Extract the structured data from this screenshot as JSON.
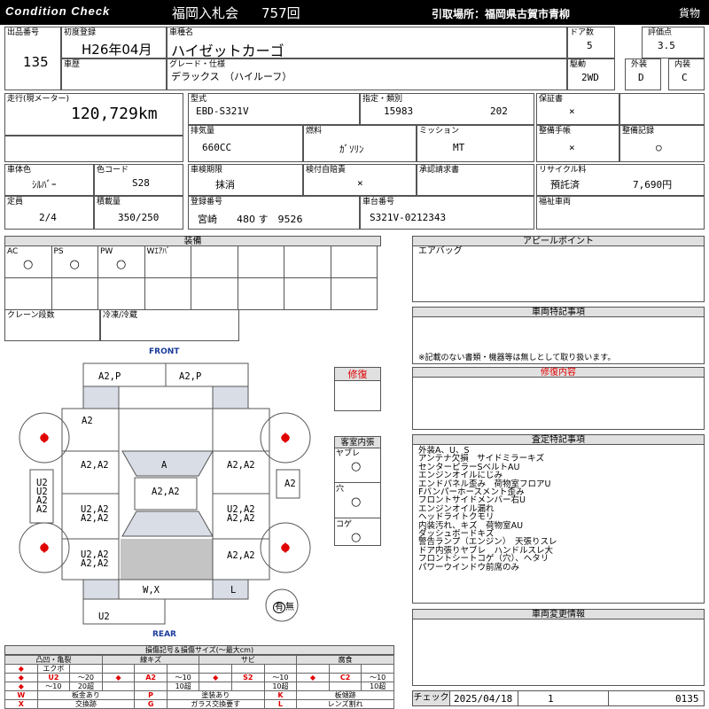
{
  "header": {
    "title_left": "Condition Check",
    "auction": "福岡入札会",
    "lot_no": "757回",
    "pickup": "引取場所：福岡県古賀市青柳",
    "kind": "貨物"
  },
  "info": {
    "lot_label": "出品番号",
    "lot": "135",
    "first_reg_label": "初度登録",
    "first_reg": "H26年04月",
    "history_label": "車歴",
    "model_label": "車種名",
    "model": "ハイゼットカーゴ",
    "grade_label": "グレード・仕様",
    "grade": "デラックス　（ハイルーフ）",
    "doors_label": "ドア数",
    "doors": "5",
    "score_label": "評価点",
    "score": "3.5",
    "drive_label": "駆動",
    "drive": "2WD",
    "ext_label": "外装",
    "ext": "D",
    "int_label": "内装",
    "int": "C",
    "mileage_label": "走行(現メーター)",
    "mileage": "120,729km",
    "type_label": "型式",
    "type": "EBD-S321V",
    "designation_label": "指定・類別",
    "designation": "15983",
    "class": "202",
    "warranty_label": "保証書",
    "warranty": "×",
    "displacement_label": "排気量",
    "displacement": "660CC",
    "fuel_label": "燃料",
    "fuel": "ｶﾞｿﾘﾝ",
    "mission_label": "ミッション",
    "mission": "MT",
    "manual_label": "整備手帳",
    "manual": "×",
    "record_label": "整備記録",
    "record": "○",
    "color_label": "車体色",
    "color": "ｼﾙﾊﾞｰ",
    "color_code_label": "色コード",
    "color_code": "S28",
    "inspection_label": "車検期限",
    "inspection": "抹消",
    "self_insp_label": "検付自賠責",
    "self_insp": "×",
    "approval_label": "承認請求書",
    "recycle_label": "リサイクル料",
    "recycle_status": "預託済",
    "recycle_fee": "7,690円",
    "capacity_label": "定員",
    "capacity": "2/4",
    "load_label": "積載量",
    "load": "350/250",
    "reg_label": "登録番号",
    "reg": "宮崎　　480 す　9526",
    "chassis_label": "車台番号",
    "chassis": "S321V-0212343",
    "welfare_label": "福祉車両"
  },
  "equipment": {
    "title": "装備",
    "items": [
      {
        "label": "AC",
        "value": "○"
      },
      {
        "label": "PS",
        "value": "○"
      },
      {
        "label": "PW",
        "value": "○"
      },
      {
        "label": "Wｴｱﾊﾞ",
        "value": ""
      }
    ],
    "crane_label": "クレーン段数",
    "freezer_label": "冷凍/冷蔵"
  },
  "appeal": {
    "title": "アピールポイント",
    "text": "エアバッグ"
  },
  "special": {
    "title": "車両特記事項",
    "note": "※記載のない書類・機器等は無しとして取り扱います。"
  },
  "repair": {
    "label": "修復",
    "content_title": "修復内容"
  },
  "interior": {
    "title": "客室内張",
    "items": [
      {
        "label": "ヤブレ",
        "value": "○"
      },
      {
        "label": "穴",
        "value": "○"
      },
      {
        "label": "コゲ",
        "value": "○"
      }
    ]
  },
  "assess": {
    "title": "査定特記事項",
    "lines": [
      "外装A、U、S",
      "アンテナ欠損　サイドミラーキズ",
      "センターピラーSベルトAU",
      "エンジンオイルにじみ",
      "エンドパネル歪み　荷物室フロアU",
      "Fバンパーホースメント歪み",
      "フロントサイドメンバー右U",
      "エンジンオイル漏れ",
      "ヘッドライトクモリ",
      "内装汚れ、キズ　荷物室AU",
      "ダッシュボードキズ",
      "警告ランプ（エンジン）　天張りスレ",
      "ドア内張りヤブレ　ハンドルスレ大",
      "フロントシートコゲ（穴）、ヘタリ",
      "パワーウインドウ前席のみ"
    ]
  },
  "change": {
    "title": "車両変更情報"
  },
  "diagram": {
    "front": "FRONT",
    "rear": "REAR",
    "marks": {
      "front_l": "A2,P",
      "front_r": "A2,P",
      "fl_fender": "A2",
      "hood": "A",
      "fl_door": "A2,A2",
      "fr_door": "A2,A2",
      "roof": "A2,A2",
      "left_side": "U2\nU2\nA2\nA2",
      "right_side": "A2",
      "rl_door": "U2,A2\nA2,A2",
      "rr_door": "U2,A2\nA2,A2",
      "rl_qtr": "U2,A2\nA2,A2",
      "rr_qtr": "A2,A2",
      "rear_c": "W,X",
      "rear_r": "L",
      "rear_bumper": "U2",
      "spare": "有",
      "spare_no": "無"
    }
  },
  "legend": {
    "title": "損傷記号＆損傷サイズ(〜最大cm)",
    "groups": [
      {
        "name": "凸凹・亀裂",
        "sub": "エクボ",
        "c1": "U2",
        "c1b": "U3",
        "s1": "〜20",
        "s1b": "20超",
        "r1": "〜10"
      },
      {
        "name": "線キズ",
        "c1": "A2",
        "s1": "〜10",
        "s1b": "10超"
      },
      {
        "name": "サビ",
        "c1": "S2",
        "s1": "〜10",
        "s1b": "10超"
      },
      {
        "name": "腐食",
        "c1": "C2",
        "s1": "〜10",
        "s1b": "10超"
      }
    ],
    "codes": [
      {
        "k": "W",
        "v": "板金あり"
      },
      {
        "k": "P",
        "v": "塗装あり"
      },
      {
        "k": "K",
        "v": "板傾跡"
      },
      {
        "k": "X",
        "v": "交換跡"
      },
      {
        "k": "G",
        "v": "ガラス交換要す"
      },
      {
        "k": "L",
        "v": "レンズ割れ"
      }
    ]
  },
  "check": {
    "label": "チェック",
    "date": "2025/04/18",
    "no": "1",
    "code": "0135"
  },
  "colors": {
    "header_bg": "#000000",
    "red": "#e00000",
    "shade": "#d8dde6"
  }
}
